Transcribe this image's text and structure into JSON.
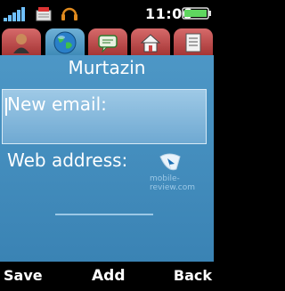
{
  "status": {
    "time": "11:06",
    "icons": [
      "signal-strength-icon",
      "message-icon",
      "headset-icon",
      "battery-icon"
    ],
    "battery_color": "#5fd65f"
  },
  "tabs": [
    {
      "icon": "contact-person-icon",
      "active": false
    },
    {
      "icon": "globe-icon",
      "active": true
    },
    {
      "icon": "chat-bubble-icon",
      "active": false
    },
    {
      "icon": "home-icon",
      "active": false
    },
    {
      "icon": "document-icon",
      "active": false
    }
  ],
  "page": {
    "title": "Murtazin",
    "field_email_label": "New email:",
    "field_web_label": "Web address:",
    "watermark": "mobile-review.com"
  },
  "softkeys": {
    "left": "Save",
    "middle": "Add",
    "right": "Back"
  },
  "colors": {
    "content_bg": "#4a93c3",
    "tab_inactive": "#b94545",
    "tab_active": "#4f9ac6"
  }
}
